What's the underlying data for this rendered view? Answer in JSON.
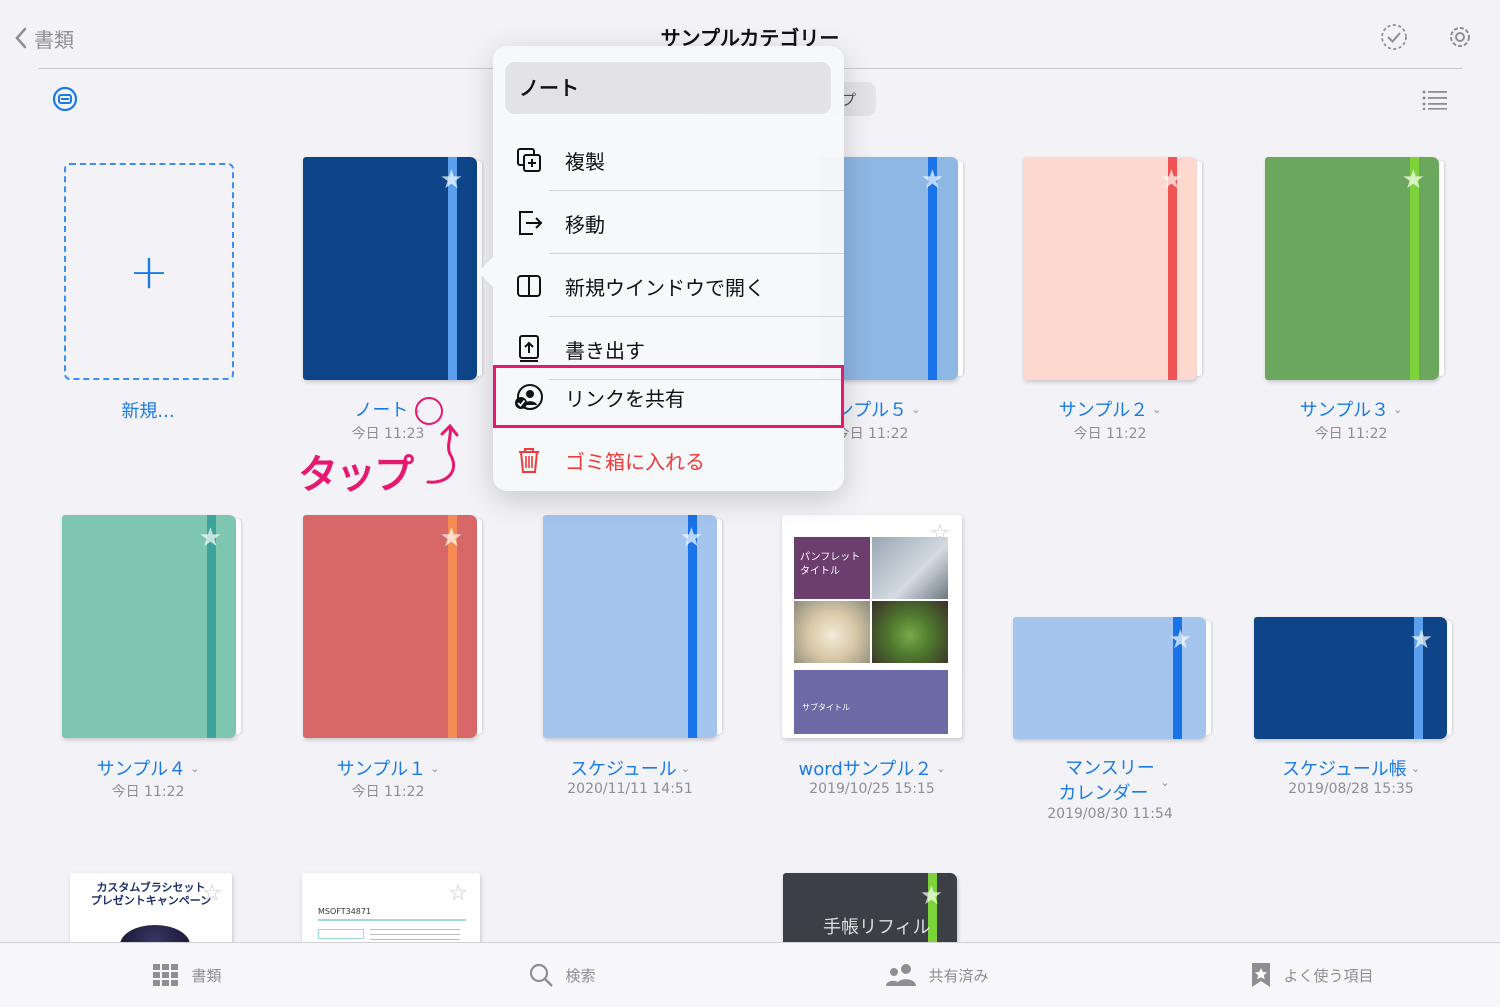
{
  "header": {
    "back_label": "書類",
    "title": "サンプルカテゴリー",
    "segment_partial": "プ"
  },
  "new_doc": {
    "label": "新規..."
  },
  "docs": [
    {
      "name": "ノート",
      "date": "今日 11:23"
    },
    {
      "name": "ンプル５",
      "date": "今日 11:22"
    },
    {
      "name": "サンプル２",
      "date": "今日 11:22"
    },
    {
      "name": "サンプル３",
      "date": "今日 11:22"
    },
    {
      "name": "サンプル４",
      "date": "今日 11:22"
    },
    {
      "name": "サンプル１",
      "date": "今日 11:22"
    },
    {
      "name": "スケジュール",
      "date": "2020/11/11 14:51"
    },
    {
      "name": "wordサンプル２",
      "date": "2019/10/25 15:15"
    },
    {
      "name_line1": "マンスリー",
      "name_line2": "カレンダー",
      "date": "2019/08/30 11:54"
    },
    {
      "name": "スケジュール帳",
      "date": "2019/08/28 15:35"
    }
  ],
  "brochure": {
    "title_line1": "パンフレット",
    "title_line2": "タイトル",
    "subtitle": "サブタイトル"
  },
  "partial_thumbs": {
    "campaign_line1": "カスタムブラシセット",
    "campaign_line2": "プレゼントキャンペーン",
    "doc_code": "MSOFT34871",
    "notebook_text": "手帳リフィル"
  },
  "menu": {
    "header": "ノート",
    "items": [
      {
        "label": "複製"
      },
      {
        "label": "移動"
      },
      {
        "label": "新規ウインドウで開く"
      },
      {
        "label": "書き出す"
      },
      {
        "label": "リンクを共有"
      },
      {
        "label": "ゴミ箱に入れる"
      }
    ]
  },
  "annotation": {
    "tap_label": "タップ"
  },
  "tabbar": {
    "tabs": [
      {
        "label": "書類"
      },
      {
        "label": "検索"
      },
      {
        "label": "共有済み"
      },
      {
        "label": "よく使う項目"
      }
    ]
  },
  "colors": {
    "accent": "#1a7be6",
    "destructive": "#ef3b3b",
    "annotation": "#e6186f"
  }
}
